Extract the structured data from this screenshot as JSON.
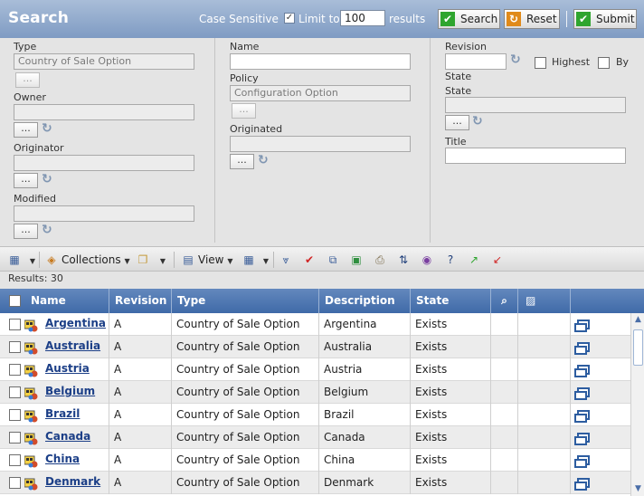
{
  "header": {
    "title": "Search",
    "case_sensitive_label": "Case Sensitive",
    "limit_label": "Limit to",
    "limit_value": "100",
    "results_label": "results",
    "search_label": "Search",
    "reset_label": "Reset",
    "submit_label": "Submit"
  },
  "filters": {
    "type_label": "Type",
    "type_value": "Country of Sale Option",
    "owner_label": "Owner",
    "originator_label": "Originator",
    "modified_label": "Modified",
    "name_label": "Name",
    "policy_label": "Policy",
    "policy_value": "Configuration Option",
    "originated_label": "Originated",
    "revision_label": "Revision",
    "highest_label": "Highest",
    "by_label": "By",
    "state_label_1": "State",
    "state_label_2": "State",
    "title_label": "Title",
    "dots": "..."
  },
  "toolbar": {
    "collections_label": "Collections",
    "view_label": "View"
  },
  "results_text": "Results: 30",
  "table": {
    "columns": [
      "Name",
      "Revision",
      "Type",
      "Description",
      "State"
    ],
    "rows": [
      {
        "name": "Argentina",
        "revision": "A",
        "type": "Country of Sale Option",
        "description": "Argentina",
        "state": "Exists"
      },
      {
        "name": "Australia",
        "revision": "A",
        "type": "Country of Sale Option",
        "description": "Australia",
        "state": "Exists"
      },
      {
        "name": "Austria",
        "revision": "A",
        "type": "Country of Sale Option",
        "description": "Austria",
        "state": "Exists"
      },
      {
        "name": "Belgium",
        "revision": "A",
        "type": "Country of Sale Option",
        "description": "Belgium",
        "state": "Exists"
      },
      {
        "name": "Brazil",
        "revision": "A",
        "type": "Country of Sale Option",
        "description": "Brazil",
        "state": "Exists"
      },
      {
        "name": "Canada",
        "revision": "A",
        "type": "Country of Sale Option",
        "description": "Canada",
        "state": "Exists"
      },
      {
        "name": "China",
        "revision": "A",
        "type": "Country of Sale Option",
        "description": "China",
        "state": "Exists"
      },
      {
        "name": "Denmark",
        "revision": "A",
        "type": "Country of Sale Option",
        "description": "Denmark",
        "state": "Exists"
      }
    ]
  },
  "colors": {
    "header_bg": "#8fa8cc",
    "table_header_bg": "#4e76b0",
    "link": "#1c3f87",
    "search_icon": "#2fa52f",
    "reset_icon": "#e08a1a"
  },
  "icons": {
    "search": "check-icon",
    "reset": "reset-icon",
    "submit": "check-icon"
  }
}
